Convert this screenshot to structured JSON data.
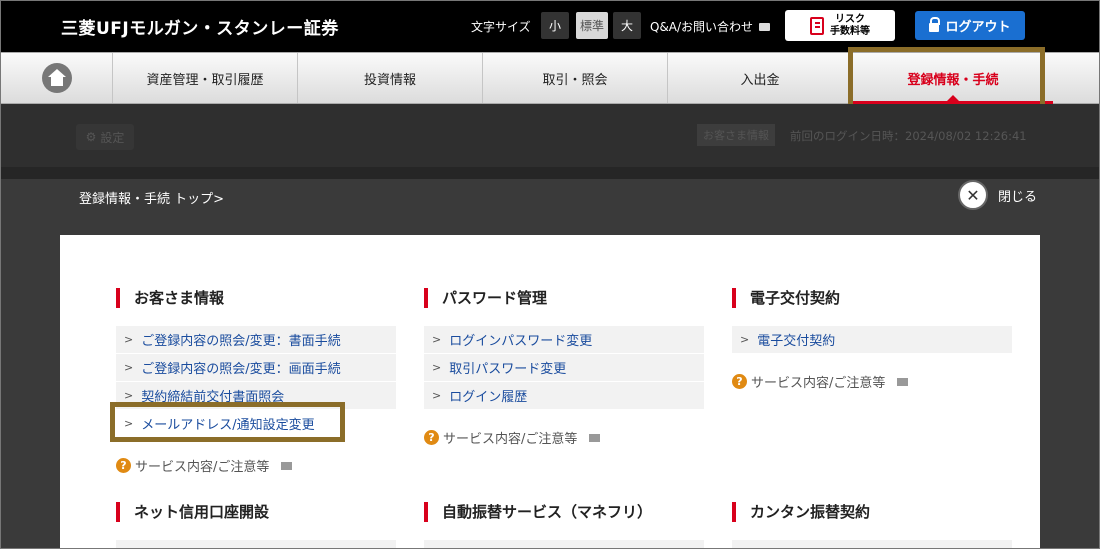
{
  "header": {
    "logo_text": "三菱UFJモルガン・スタンレー証券",
    "font_size_label": "文字サイズ",
    "font_size_options": {
      "small": "小",
      "standard": "標準",
      "large": "大"
    },
    "qa_label": "Q&A/お問い合わせ",
    "risk_line1": "リスク",
    "risk_line2": "手数料等",
    "logout_label": "ログアウト"
  },
  "nav": {
    "items": [
      {
        "label": "資産管理・取引履歴"
      },
      {
        "label": "投資情報"
      },
      {
        "label": "取引・照会"
      },
      {
        "label": "入出金"
      },
      {
        "label": "登録情報・手続"
      }
    ],
    "active_index": 4,
    "active_color": "#d8001c"
  },
  "subheader": {
    "settings_label": "設定",
    "badge_label": "お客さま情報",
    "last_login": "前回のログイン日時：2024/08/02 12:26:41"
  },
  "panel": {
    "breadcrumb": "登録情報・手続 トップ>",
    "close_label": "閉じる",
    "sections": [
      {
        "title": "お客さま情報",
        "links": [
          "ご登録内容の照会/変更：書面手続",
          "ご登録内容の照会/変更：画面手続",
          "契約締結前交付書面照会",
          "メールアドレス/通知設定変更"
        ],
        "note": "サービス内容/ご注意等"
      },
      {
        "title": "パスワード管理",
        "links": [
          "ログインパスワード変更",
          "取引パスワード変更",
          "ログイン履歴"
        ],
        "note": "サービス内容/ご注意等"
      },
      {
        "title": "電子交付契約",
        "links": [
          "電子交付契約"
        ],
        "note": "サービス内容/ご注意等"
      }
    ],
    "lower_sections": [
      {
        "title": "ネット信用口座開設"
      },
      {
        "title": "自動振替サービス（マネフリ）"
      },
      {
        "title": "カンタン振替契約"
      }
    ]
  },
  "colors": {
    "accent": "#d8001c",
    "link": "#1a4c9e",
    "highlight": "#8b6d29",
    "logout": "#1a6fd1"
  }
}
